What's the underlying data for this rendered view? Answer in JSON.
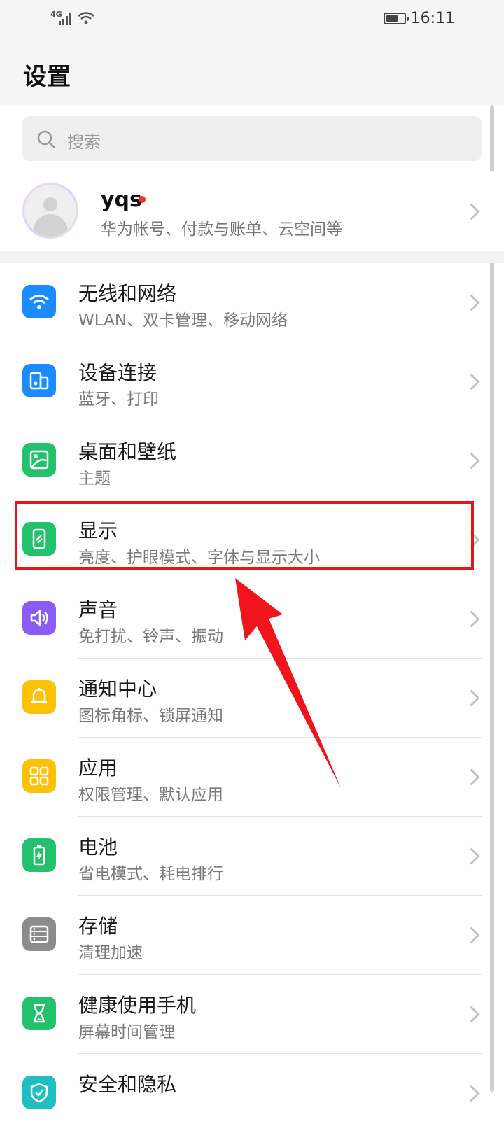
{
  "status_bar": {
    "network": "4G",
    "time": "16:11"
  },
  "header": {
    "title": "设置"
  },
  "search": {
    "placeholder": "搜索"
  },
  "account": {
    "name": "yqs",
    "subtitle": "华为帐号、付款与账单、云空间等"
  },
  "items": [
    {
      "title": "无线和网络",
      "subtitle": "WLAN、双卡管理、移动网络",
      "icon": "wifi-icon",
      "color": "#1a8cff"
    },
    {
      "title": "设备连接",
      "subtitle": "蓝牙、打印",
      "icon": "device-connection-icon",
      "color": "#1a8cff"
    },
    {
      "title": "桌面和壁纸",
      "subtitle": "主题",
      "icon": "wallpaper-icon",
      "color": "#23c16b"
    },
    {
      "title": "显示",
      "subtitle": "亮度、护眼模式、字体与显示大小",
      "icon": "display-icon",
      "color": "#23c16b"
    },
    {
      "title": "声音",
      "subtitle": "免打扰、铃声、振动",
      "icon": "sound-icon",
      "color": "#8a5cf6"
    },
    {
      "title": "通知中心",
      "subtitle": "图标角标、锁屏通知",
      "icon": "bell-icon",
      "color": "#ffc107"
    },
    {
      "title": "应用",
      "subtitle": "权限管理、默认应用",
      "icon": "apps-icon",
      "color": "#ffc107"
    },
    {
      "title": "电池",
      "subtitle": "省电模式、耗电排行",
      "icon": "battery-icon",
      "color": "#23c16b"
    },
    {
      "title": "存储",
      "subtitle": "清理加速",
      "icon": "storage-icon",
      "color": "#8c8c8c"
    },
    {
      "title": "健康使用手机",
      "subtitle": "屏幕时间管理",
      "icon": "hourglass-icon",
      "color": "#23c16b"
    },
    {
      "title": "安全和隐私",
      "subtitle": "",
      "icon": "shield-icon",
      "color": "#1fbfbf"
    }
  ],
  "colors": {
    "highlight": "#e8141c",
    "arrow": "#f2141c"
  }
}
